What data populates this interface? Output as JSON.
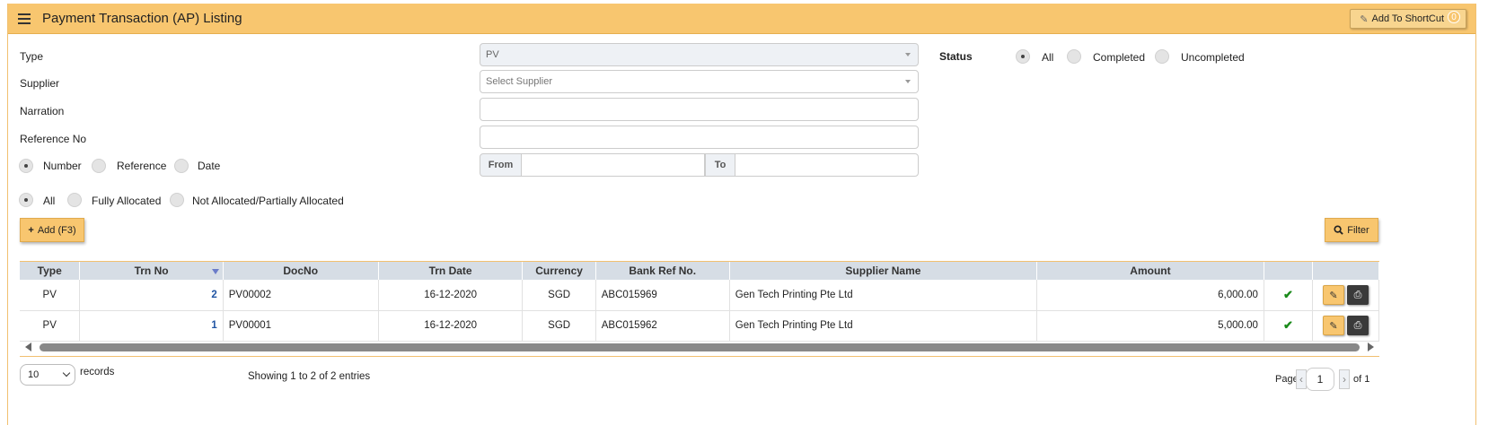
{
  "header": {
    "title": "Payment Transaction (AP) Listing",
    "shortcut_label": "Add To ShortCut",
    "shortcut_count": "0"
  },
  "form": {
    "type_label": "Type",
    "type_value": "PV",
    "supplier_label": "Supplier",
    "supplier_placeholder": "Select Supplier",
    "narration_label": "Narration",
    "reference_label": "Reference No",
    "sort_options": [
      "Number",
      "Reference",
      "Date"
    ],
    "from_label": "From",
    "to_label": "To",
    "status_label": "Status",
    "status_options": [
      "All",
      "Completed",
      "Uncompleted"
    ],
    "alloc_options": [
      "All",
      "Fully Allocated",
      "Not Allocated/Partially Allocated"
    ]
  },
  "actions": {
    "add_label": "Add (F3)",
    "filter_label": "Filter"
  },
  "table": {
    "columns": [
      "Type",
      "Trn No",
      "DocNo",
      "Trn Date",
      "Currency",
      "Bank Ref No.",
      "Supplier Name",
      "Amount",
      "",
      ""
    ],
    "rows": [
      {
        "type": "PV",
        "trn_no": "2",
        "doc_no": "PV00002",
        "trn_date": "16-12-2020",
        "currency": "SGD",
        "bank_ref": "ABC015969",
        "supplier": "Gen Tech Printing Pte Ltd",
        "amount": "6,000.00"
      },
      {
        "type": "PV",
        "trn_no": "1",
        "doc_no": "PV00001",
        "trn_date": "16-12-2020",
        "currency": "SGD",
        "bank_ref": "ABC015962",
        "supplier": "Gen Tech Printing Pte Ltd",
        "amount": "5,000.00"
      }
    ]
  },
  "footer": {
    "page_size": "10",
    "records_label": "records",
    "showing_text": "Showing 1 to 2 of 2 entries",
    "page_label": "Page",
    "page_value": "1",
    "of_label": "of 1"
  },
  "icons": {
    "menu": "hamburger-icon",
    "edit": "edit-icon",
    "print": "print-icon",
    "search": "search-icon",
    "plus": "plus-icon",
    "check": "check-icon",
    "sort": "sort-desc-icon"
  },
  "colors": {
    "accent": "#f8c66f",
    "header_row": "#d6dde5",
    "check": "#1a8a1a"
  }
}
